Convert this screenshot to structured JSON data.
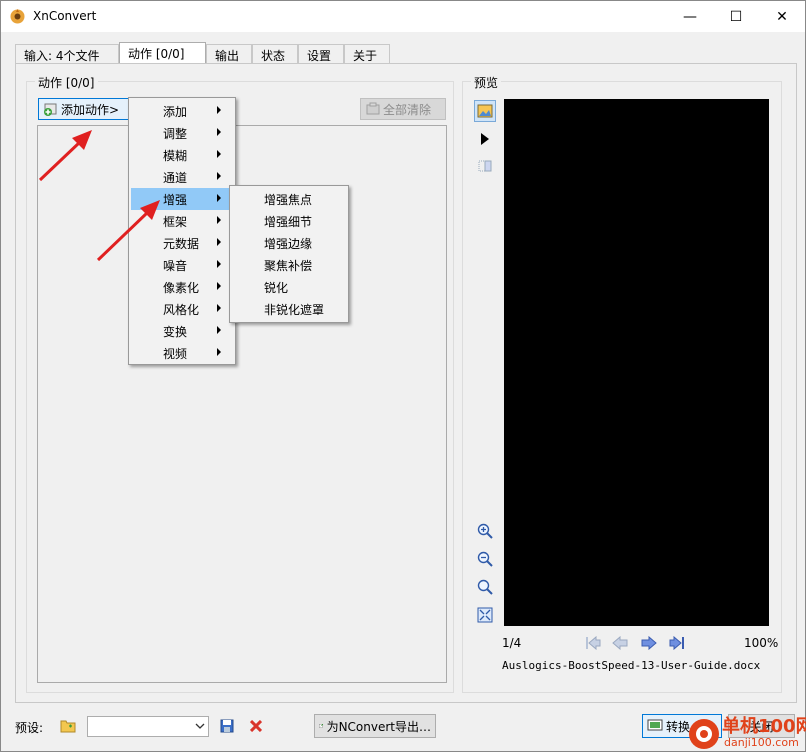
{
  "window": {
    "title": "XnConvert",
    "min_glyph": "—",
    "max_glyph": "☐",
    "close_glyph": "✕"
  },
  "tabs": [
    {
      "label": "输入:  4个文件"
    },
    {
      "label": "动作 [0/0]"
    },
    {
      "label": "输出"
    },
    {
      "label": "状态"
    },
    {
      "label": "设置"
    },
    {
      "label": "关于"
    }
  ],
  "actions_panel": {
    "group_label": "动作 [0/0]",
    "add_action_label": "添加动作>",
    "clear_all_label": "全部清除"
  },
  "menu": {
    "items": [
      "添加",
      "调整",
      "模糊",
      "通道",
      "增强",
      "框架",
      "元数据",
      "噪音",
      "像素化",
      "风格化",
      "变换",
      "视频"
    ],
    "highlighted_index": 4
  },
  "submenu": {
    "items": [
      "增强焦点",
      "增强细节",
      "增强边缘",
      "聚焦补偿",
      "锐化",
      "非锐化遮罩"
    ]
  },
  "preview": {
    "group_label": "预览",
    "page_indicator": "1/4",
    "zoom": "100%",
    "filename": "Auslogics-BoostSpeed-13-User-Guide.docx"
  },
  "footer": {
    "preset_label": "预设:",
    "preset_value": "",
    "export_label": "为NConvert导出…",
    "convert_label": "转换",
    "close_label": "关闭"
  },
  "watermark": {
    "site_name": "单机100网",
    "url": "danji100.com"
  },
  "colors": {
    "menu_highlight": "#91c9f7",
    "arrow_red": "#e02020",
    "preview_bg": "#000000"
  }
}
